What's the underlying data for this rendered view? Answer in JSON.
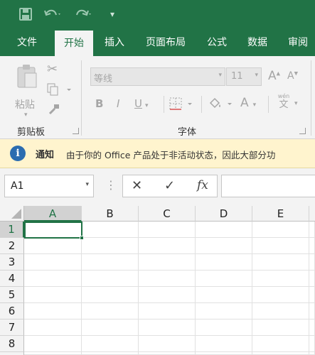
{
  "colors": {
    "brand": "#217346",
    "ribbon_bg": "#f3f3f3",
    "notice_bg": "#fff4ce",
    "info_blue": "#2b6cb0"
  },
  "qat": {
    "save_icon": "save-icon",
    "undo_icon": "undo-icon",
    "redo_icon": "redo-icon",
    "customize_glyph": "▾"
  },
  "tabs": [
    {
      "label": "文件"
    },
    {
      "label": "开始"
    },
    {
      "label": "插入"
    },
    {
      "label": "页面布局"
    },
    {
      "label": "公式"
    },
    {
      "label": "数据"
    },
    {
      "label": "审阅"
    }
  ],
  "active_tab": "开始",
  "ribbon": {
    "clipboard": {
      "paste_label": "粘贴",
      "group_label": "剪贴板"
    },
    "font": {
      "font_name": "等线",
      "font_size": "11",
      "bold": "B",
      "italic": "I",
      "underline": "U",
      "grow_font": "A",
      "shrink_font": "A",
      "font_color": "A",
      "phonetic_top": "wén",
      "phonetic_bottom": "文",
      "group_label": "字体"
    }
  },
  "notice": {
    "title": "通知",
    "message": "由于你的 Office 产品处于非活动状态，因此大部分功"
  },
  "formula_bar": {
    "name_box": "A1",
    "cancel": "✕",
    "enter": "✓",
    "fx": "fx",
    "separator": "⋮"
  },
  "grid": {
    "columns": [
      "A",
      "B",
      "C",
      "D",
      "E"
    ],
    "rows": [
      "1",
      "2",
      "3",
      "4",
      "5",
      "6",
      "7",
      "8"
    ],
    "selected_cell": "A1"
  }
}
